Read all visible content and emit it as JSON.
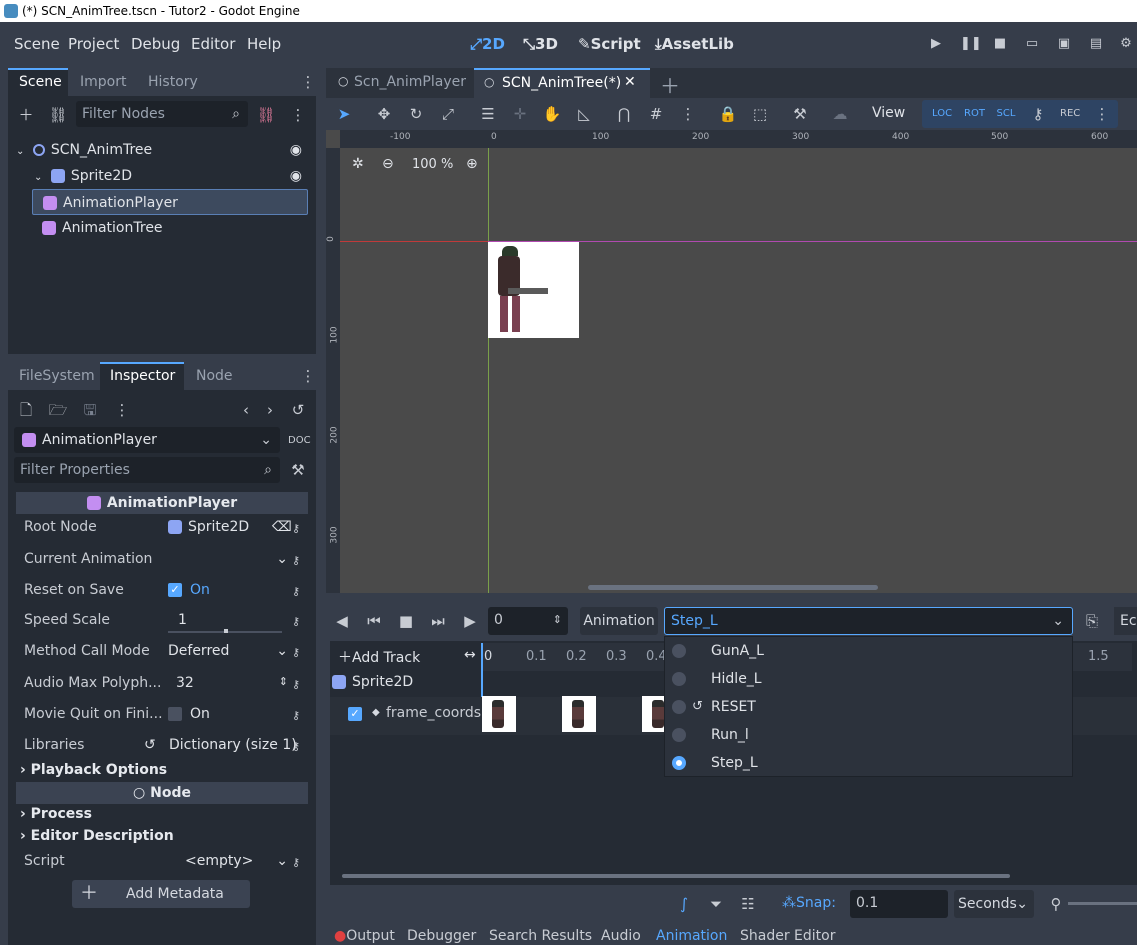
{
  "window_title": "(*) SCN_AnimTree.tscn - Tutor2 - Godot Engine",
  "menu": [
    "Scene",
    "Project",
    "Debug",
    "Editor",
    "Help"
  ],
  "workspaces": {
    "w2d": "2D",
    "w3d": "3D",
    "script": "Script",
    "assetlib": "AssetLib",
    "active": "2D"
  },
  "scene_dock": {
    "tabs": [
      "Scene",
      "Import",
      "History"
    ],
    "filter_placeholder": "Filter Nodes",
    "tree": [
      "SCN_AnimTree",
      "Sprite2D",
      "AnimationPlayer",
      "AnimationTree"
    ]
  },
  "inspector_dock": {
    "tabs": [
      "FileSystem",
      "Inspector",
      "Node"
    ],
    "object_name": "AnimationPlayer",
    "filter_placeholder": "Filter Properties",
    "section_title": "AnimationPlayer",
    "properties": [
      {
        "label": "Root Node",
        "value": "Sprite2D"
      },
      {
        "label": "Current Animation",
        "value": ""
      },
      {
        "label": "Reset on Save",
        "value": "On"
      },
      {
        "label": "Speed Scale",
        "value": "1"
      },
      {
        "label": "Method Call Mode",
        "value": "Deferred"
      },
      {
        "label": "Audio Max Polyph...",
        "value": "32"
      },
      {
        "label": "Movie Quit on Fini...",
        "value": "On"
      },
      {
        "label": "Libraries",
        "value": "Dictionary (size 1)"
      }
    ],
    "playback_options": "Playback Options",
    "node_section": "Node",
    "process": "Process",
    "editor_description": "Editor Description",
    "script_label": "Script",
    "script_value": "<empty>",
    "add_metadata": "Add Metadata"
  },
  "scene_tabs": [
    "Scn_AnimPlayer",
    "SCN_AnimTree(*)"
  ],
  "toolbar": {
    "view_label": "View"
  },
  "viewport": {
    "zoom": "100 %",
    "ruler_h": [
      "-100",
      "0",
      "100",
      "200",
      "300",
      "400",
      "500",
      "600"
    ],
    "ruler_v": [
      "0",
      "100",
      "200",
      "300"
    ]
  },
  "animation": {
    "time_value": "0",
    "label": "Animation",
    "current": "Step_L",
    "add_track": "Add Track",
    "timeline_ticks": [
      "0",
      "0.1",
      "0.2",
      "0.3",
      "0.4",
      "1.5"
    ],
    "track_node": "Sprite2D",
    "track_property": "frame_coords",
    "dropdown": [
      "GunA_L",
      "Hidle_L",
      "RESET",
      "Run_l",
      "Step_L"
    ],
    "snap_label": "Snap:",
    "snap_value": "0.1",
    "snap_unit": "Seconds",
    "edit_cut": "Ec"
  },
  "bottom_tabs": [
    "Output",
    "Debugger",
    "Search Results",
    "Audio",
    "Animation",
    "Shader Editor"
  ],
  "colors": {
    "accent": "#57a8ff",
    "bg": "#363d4a",
    "panel": "#252b34"
  }
}
